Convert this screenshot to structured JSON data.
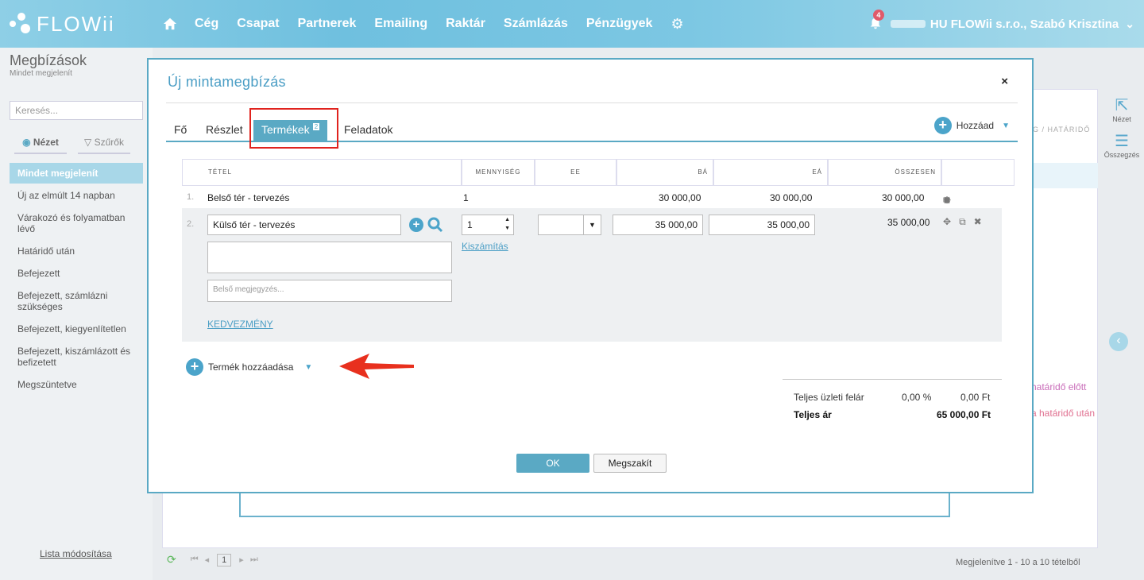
{
  "nav": {
    "brand": "FLOWii",
    "items": [
      "Cég",
      "Csapat",
      "Partnerek",
      "Emailing",
      "Raktár",
      "Számlázás",
      "Pénzügyek"
    ],
    "notification_count": "4",
    "user": "HU FLOWii s.r.o., Szabó Krisztina"
  },
  "sidebar": {
    "title": "Megbízások",
    "subtitle": "Mindet megjelenít",
    "search_placeholder": "Keresés...",
    "tab_view": "Nézet",
    "tab_filters": "Szűrők",
    "items": [
      "Mindet megjelenít",
      "Új az elmúlt 14 napban",
      "Várakozó és folyamatban lévő",
      "Határidő után",
      "Befejezett",
      "Befejezett, számlázni szükséges",
      "Befejezett, kiegyenlítetlen",
      "Befejezett, kiszámlázott és befizetett",
      "Megszüntetve"
    ],
    "footer_link": "Lista módosítása"
  },
  "background": {
    "right_view": "Nézet",
    "right_summary": "Összegzés",
    "col_header": "G / HATÁRIDŐ",
    "pink1": "határidő előtt",
    "pink2": "a határidő után",
    "page": "1",
    "info": "Megjelenítve 1 - 10 a 10 tételből"
  },
  "modal": {
    "title": "Új mintamegbízás",
    "close": "×",
    "tabs": {
      "fo": "Fő",
      "reszlet": "Részlet",
      "termekek": "Termékek",
      "termekek_count": "2",
      "feladatok": "Feladatok"
    },
    "add_label": "Hozzáad",
    "table": {
      "headers": {
        "item": "TÉTEL",
        "qty": "MENNYISÉG",
        "unit": "EE",
        "ba": "BÁ",
        "ea": "EÁ",
        "total": "ÖSSZESEN"
      },
      "row1": {
        "num": "1.",
        "name": "Belső tér - tervezés",
        "qty": "1",
        "ba": "30 000,00",
        "ea": "30 000,00",
        "total": "30 000,00"
      },
      "row2": {
        "num": "2.",
        "name": "Külső tér - tervezés",
        "qty": "1",
        "ba": "35 000,00",
        "ea": "35 000,00",
        "total": "35 000,00",
        "calc_link": "Kiszámítás",
        "note_placeholder": "Belső megjegyzés...",
        "discount_link": "KEDVEZMÉNY"
      }
    },
    "add_product": "Termék hozzáadása",
    "totals": {
      "markup_label": "Teljes üzleti felár",
      "markup_pct": "0,00 %",
      "markup_amount": "0,00 Ft",
      "total_label": "Teljes ár",
      "total_amount": "65 000,00 Ft"
    },
    "ok": "OK",
    "cancel": "Megszakít"
  },
  "colors": {
    "accent": "#5aa9c4",
    "annotation_red": "#e0231e"
  }
}
